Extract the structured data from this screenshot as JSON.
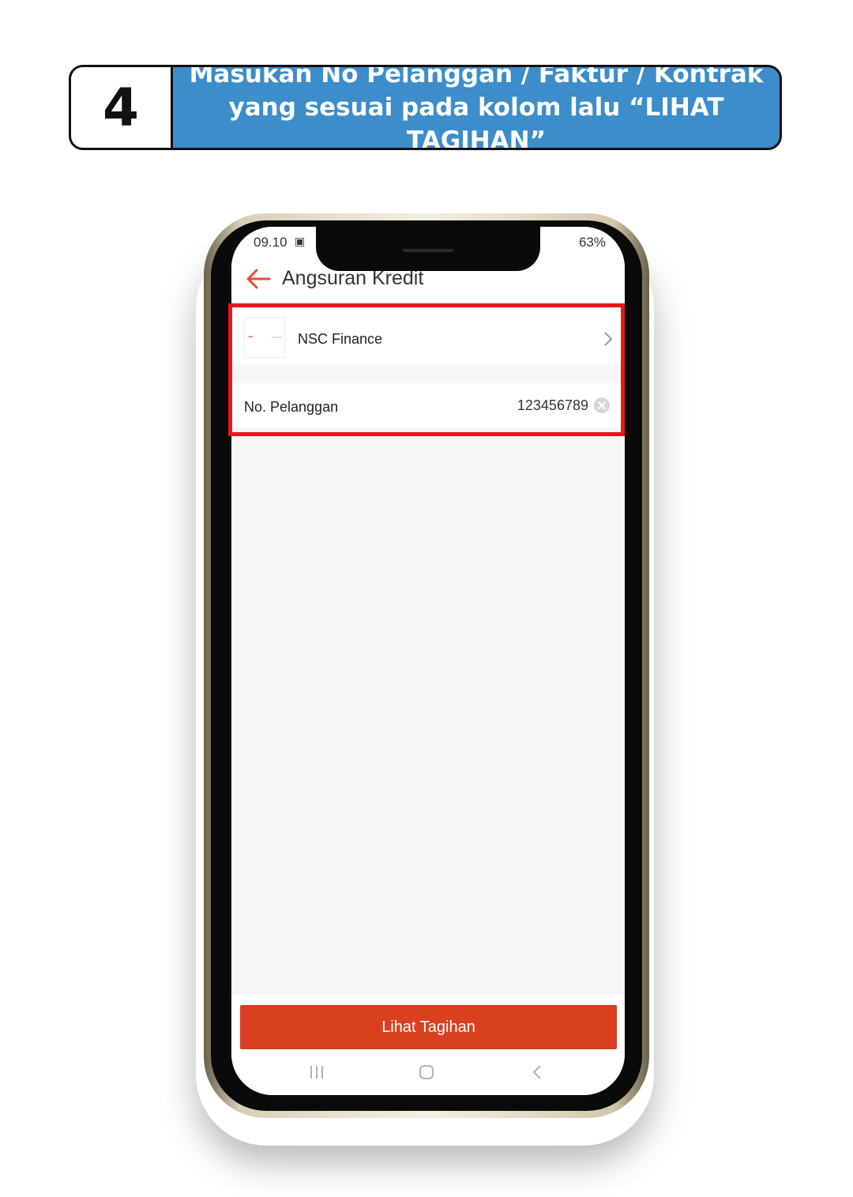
{
  "step": {
    "number": "4",
    "instruction_line1": "Masukan No Pelanggan / Faktur / Kontrak",
    "instruction_line2": "yang sesuai pada kolom lalu “LIHAT TAGIHAN”"
  },
  "status_bar": {
    "time": "09.10",
    "battery": "63%"
  },
  "header": {
    "title": "Angsuran Kredit"
  },
  "provider": {
    "logo_text": "NSC",
    "name": "NSC Finance"
  },
  "customer_field": {
    "label": "No. Pelanggan",
    "value": "123456789"
  },
  "action": {
    "button_label": "Lihat Tagihan"
  },
  "colors": {
    "banner_blue": "#3c8dc9",
    "accent_orange": "#d9401f",
    "highlight_red": "#e8151b"
  }
}
